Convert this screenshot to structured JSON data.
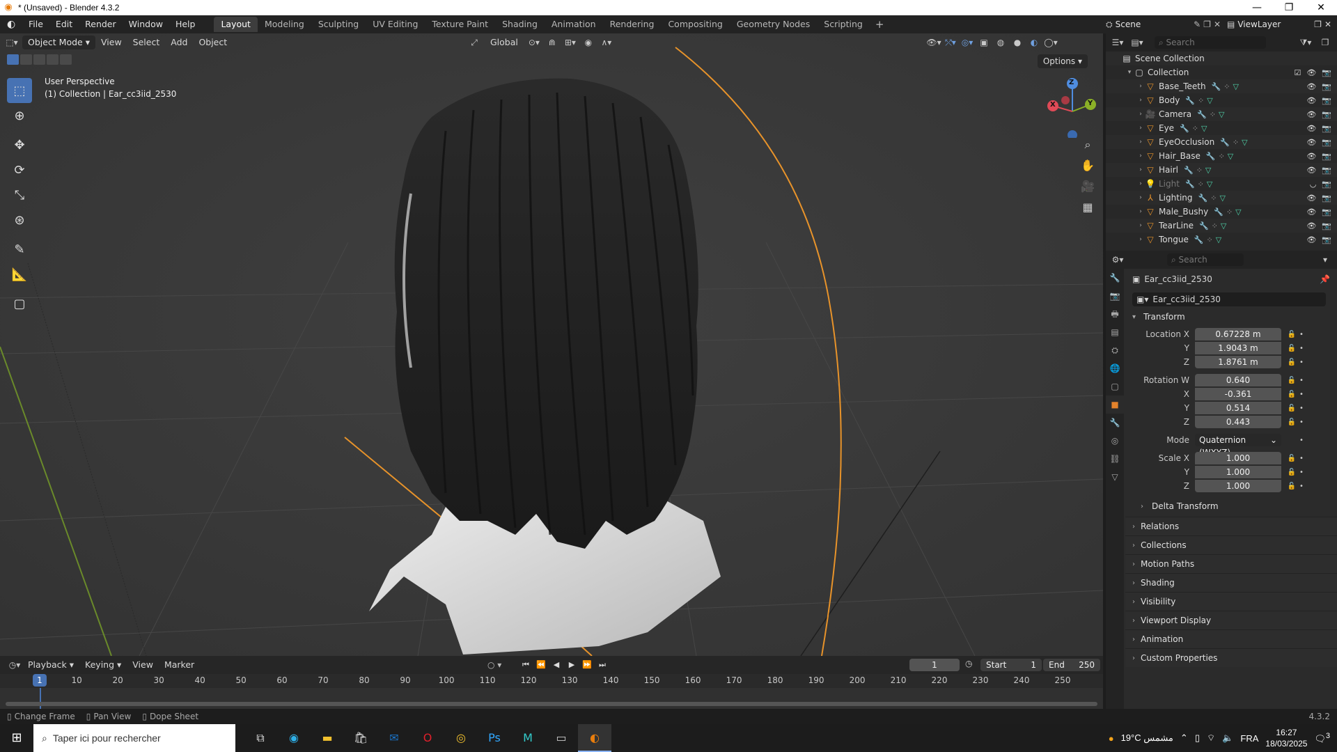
{
  "window": {
    "title": "* (Unsaved) - Blender 4.3.2",
    "controls": [
      "—",
      "❐",
      "✕"
    ]
  },
  "topbar": {
    "menus": [
      "File",
      "Edit",
      "Render",
      "Window",
      "Help"
    ],
    "workspaces": [
      "Layout",
      "Modeling",
      "Sculpting",
      "UV Editing",
      "Texture Paint",
      "Shading",
      "Animation",
      "Rendering",
      "Compositing",
      "Geometry Nodes",
      "Scripting"
    ],
    "active_workspace": "Layout",
    "scene": "Scene",
    "view_layer": "ViewLayer"
  },
  "viewport": {
    "mode": "Object Mode",
    "menus": [
      "View",
      "Select",
      "Add",
      "Object"
    ],
    "transform_orientation": "Global",
    "options_label": "Options",
    "view_name": "User Perspective",
    "collection_info": "(1) Collection | Ear_cc3iid_2530",
    "tools": [
      "select-box",
      "cursor",
      "move",
      "rotate",
      "scale",
      "transform",
      "annotate",
      "measure",
      "add-cube"
    ],
    "gizmo_axes": {
      "x": "X",
      "y": "Y",
      "z": "Z"
    },
    "colors": {
      "x_axis": "#e04a57",
      "y_axis": "#8bb027",
      "z_axis": "#4f8de0",
      "selection": "#ff9a2e"
    }
  },
  "timeline": {
    "menus": [
      "Playback",
      "Keying",
      "View",
      "Marker"
    ],
    "current_frame": "1",
    "start_label": "Start",
    "start_value": "1",
    "end_label": "End",
    "end_value": "250",
    "ruler_ticks": [
      "1",
      "10",
      "20",
      "30",
      "40",
      "50",
      "60",
      "70",
      "80",
      "90",
      "100",
      "110",
      "120",
      "130",
      "140",
      "150",
      "160",
      "170",
      "180",
      "190",
      "200",
      "210",
      "220",
      "230",
      "240",
      "250"
    ]
  },
  "statusbar": {
    "hints": [
      "Change Frame",
      "Pan View",
      "Dope Sheet"
    ],
    "version": "4.3.2"
  },
  "outliner": {
    "search_placeholder": "Search",
    "scene_collection": "Scene Collection",
    "collection": "Collection",
    "items": [
      {
        "name": "Base_Teeth",
        "icon": "mesh-icon",
        "disabled": false
      },
      {
        "name": "Body",
        "icon": "mesh-icon",
        "disabled": false
      },
      {
        "name": "Camera",
        "icon": "camera-icon",
        "disabled": false
      },
      {
        "name": "Eye",
        "icon": "mesh-icon",
        "disabled": false
      },
      {
        "name": "EyeOcclusion",
        "icon": "mesh-icon",
        "disabled": false
      },
      {
        "name": "Hair_Base",
        "icon": "mesh-icon",
        "disabled": false
      },
      {
        "name": "Hairl",
        "icon": "mesh-icon",
        "disabled": false
      },
      {
        "name": "Light",
        "icon": "light-icon",
        "disabled": true
      },
      {
        "name": "Lighting",
        "icon": "armature-icon",
        "disabled": false
      },
      {
        "name": "Male_Bushy",
        "icon": "mesh-icon",
        "disabled": false
      },
      {
        "name": "TearLine",
        "icon": "mesh-icon",
        "disabled": false
      },
      {
        "name": "Tongue",
        "icon": "mesh-icon",
        "disabled": false
      }
    ]
  },
  "properties": {
    "search_placeholder": "Search",
    "object_name": "Ear_cc3iid_2530",
    "object_field": "Ear_cc3iid_2530",
    "transform_label": "Transform",
    "location": {
      "label": "Location X",
      "x": "0.67228 m",
      "y": "1.9043 m",
      "z": "1.8761 m"
    },
    "rotation": {
      "label": "Rotation W",
      "w": "0.640",
      "x": "-0.361",
      "y": "0.514",
      "z": "0.443"
    },
    "mode_label": "Mode",
    "mode_value": "Quaternion (WXYZ)",
    "scale": {
      "label": "Scale X",
      "x": "1.000",
      "y": "1.000",
      "z": "1.000"
    },
    "axis_labels": {
      "x": "X",
      "y": "Y",
      "z": "Z"
    },
    "delta_transform": "Delta Transform",
    "panels": [
      "Relations",
      "Collections",
      "Motion Paths",
      "Shading",
      "Visibility",
      "Viewport Display",
      "Animation",
      "Custom Properties"
    ]
  },
  "taskbar": {
    "search_placeholder": "Taper ici pour rechercher",
    "weather": "19°C  مشمس",
    "language": "FRA",
    "time": "16:27",
    "date": "18/03/2025",
    "notification_count": "3"
  }
}
